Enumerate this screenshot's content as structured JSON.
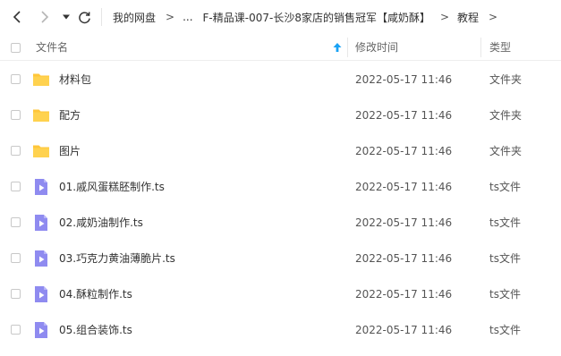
{
  "nav": {
    "back_icon": "chevron-left-icon",
    "forward_icon": "chevron-right-icon",
    "history_icon": "caret-down-icon",
    "refresh_icon": "refresh-icon"
  },
  "breadcrumb": {
    "items": [
      "我的网盘",
      "...",
      "F-精品课-007-长沙8家店的销售冠军【咸奶酥】",
      "教程"
    ],
    "separator": ">"
  },
  "table": {
    "headers": {
      "name": "文件名",
      "modified": "修改时间",
      "type": "类型"
    },
    "sort_icon": "sort-up-arrow-icon",
    "rows": [
      {
        "name": "材料包",
        "modified": "2022-05-17 11:46",
        "type": "文件夹",
        "icon": "folder-icon"
      },
      {
        "name": "配方",
        "modified": "2022-05-17 11:46",
        "type": "文件夹",
        "icon": "folder-icon"
      },
      {
        "name": "图片",
        "modified": "2022-05-17 11:46",
        "type": "文件夹",
        "icon": "folder-icon"
      },
      {
        "name": "01.戚风蛋糕胚制作.ts",
        "modified": "2022-05-17 11:46",
        "type": "ts文件",
        "icon": "video-file-icon"
      },
      {
        "name": "02.咸奶油制作.ts",
        "modified": "2022-05-17 11:46",
        "type": "ts文件",
        "icon": "video-file-icon"
      },
      {
        "name": "03.巧克力黄油薄脆片.ts",
        "modified": "2022-05-17 11:46",
        "type": "ts文件",
        "icon": "video-file-icon"
      },
      {
        "name": "04.酥粒制作.ts",
        "modified": "2022-05-17 11:46",
        "type": "ts文件",
        "icon": "video-file-icon"
      },
      {
        "name": "05.组合装饰.ts",
        "modified": "2022-05-17 11:46",
        "type": "ts文件",
        "icon": "video-file-icon"
      }
    ]
  },
  "colors": {
    "folder": "#ffc63a",
    "video": "#8f8bf0",
    "sort_arrow": "#1aa3f5"
  }
}
